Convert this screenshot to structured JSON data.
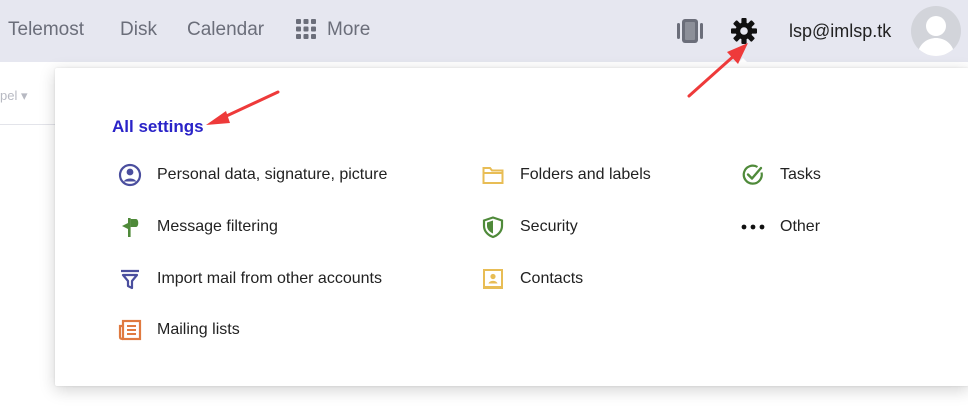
{
  "nav": {
    "telemost": "Telemost",
    "disk": "Disk",
    "calendar": "Calendar",
    "more": "More"
  },
  "header": {
    "user_email": "lsp@imlsp.tk"
  },
  "background": {
    "partial_label": "pel ▾"
  },
  "settings": {
    "title": "All settings",
    "columns": [
      [
        {
          "label": "Personal data, signature, picture",
          "icon": "person-circle-icon"
        },
        {
          "label": "Message filtering",
          "icon": "filter-sign-icon"
        },
        {
          "label": "Import mail from other accounts",
          "icon": "funnel-icon"
        },
        {
          "label": "Mailing lists",
          "icon": "newspaper-icon"
        }
      ],
      [
        {
          "label": "Folders and labels",
          "icon": "folder-icon"
        },
        {
          "label": "Security",
          "icon": "shield-icon"
        },
        {
          "label": "Contacts",
          "icon": "contact-card-icon"
        }
      ],
      [
        {
          "label": "Tasks",
          "icon": "check-circle-icon"
        },
        {
          "label": "Other",
          "icon": "ellipsis-icon"
        }
      ]
    ]
  },
  "colors": {
    "topbar_bg": "#e6e7f0",
    "title_blue": "#2a23c8",
    "annotation_red": "#ee3a3a"
  }
}
